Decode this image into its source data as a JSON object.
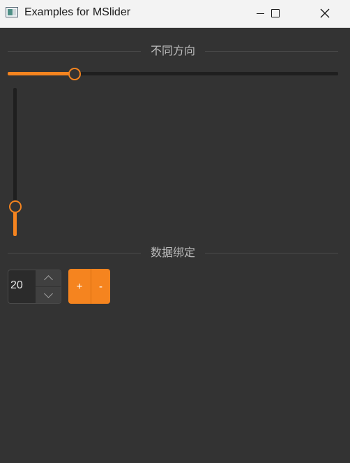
{
  "window": {
    "title": "Examples for MSlider",
    "icon": "app-window-icon",
    "controls": [
      "minimize-icon",
      "maximize-icon",
      "close-icon"
    ]
  },
  "sections": {
    "orientation_label": "不同方向",
    "binding_label": "数据绑定"
  },
  "horizontal_slider": {
    "value_fraction": 0.2
  },
  "vertical_slider": {
    "value_fraction": 0.2
  },
  "spinbox": {
    "value": "20"
  },
  "buttons": {
    "increase": "+",
    "decrease": "-"
  },
  "colors": {
    "accent": "#f5841f",
    "background": "#333333",
    "track": "#1f1f1f"
  }
}
